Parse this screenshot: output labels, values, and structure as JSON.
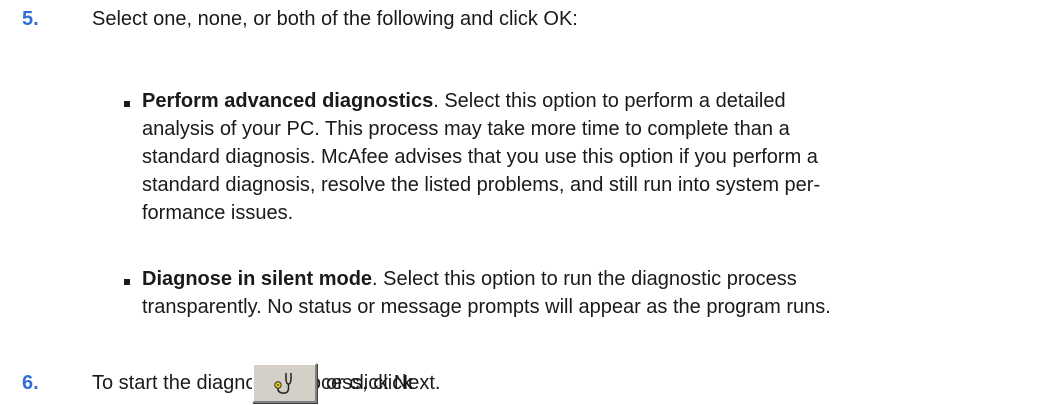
{
  "steps": [
    {
      "number": "5.",
      "text": "Select one, none, or both of the following and click OK:",
      "bullets": [
        {
          "title": "Perform advanced diagnostics",
          "description_lines": [
            ". Select this option to perform a detailed",
            "analysis of your PC. This process may take more time to complete than a",
            "standard diagnosis. McAfee advises that you use this option if you perform a",
            "standard diagnosis, resolve the listed problems, and still run into system per-",
            "formance issues."
          ]
        },
        {
          "title": "Diagnose in silent mode",
          "description_lines": [
            ". Select this option to run the diagnostic process",
            "transparently. No status or message prompts will appear as the program runs."
          ]
        }
      ]
    },
    {
      "number": "6.",
      "text_before": "To start the diagnostic process, click",
      "text_after": "or click Next.",
      "button_icon": "diagnose-stethoscope-icon"
    }
  ],
  "colors": {
    "step_number": "#2f6fd6",
    "text": "#1a1a1a",
    "button_face": "#d4d0c8"
  }
}
